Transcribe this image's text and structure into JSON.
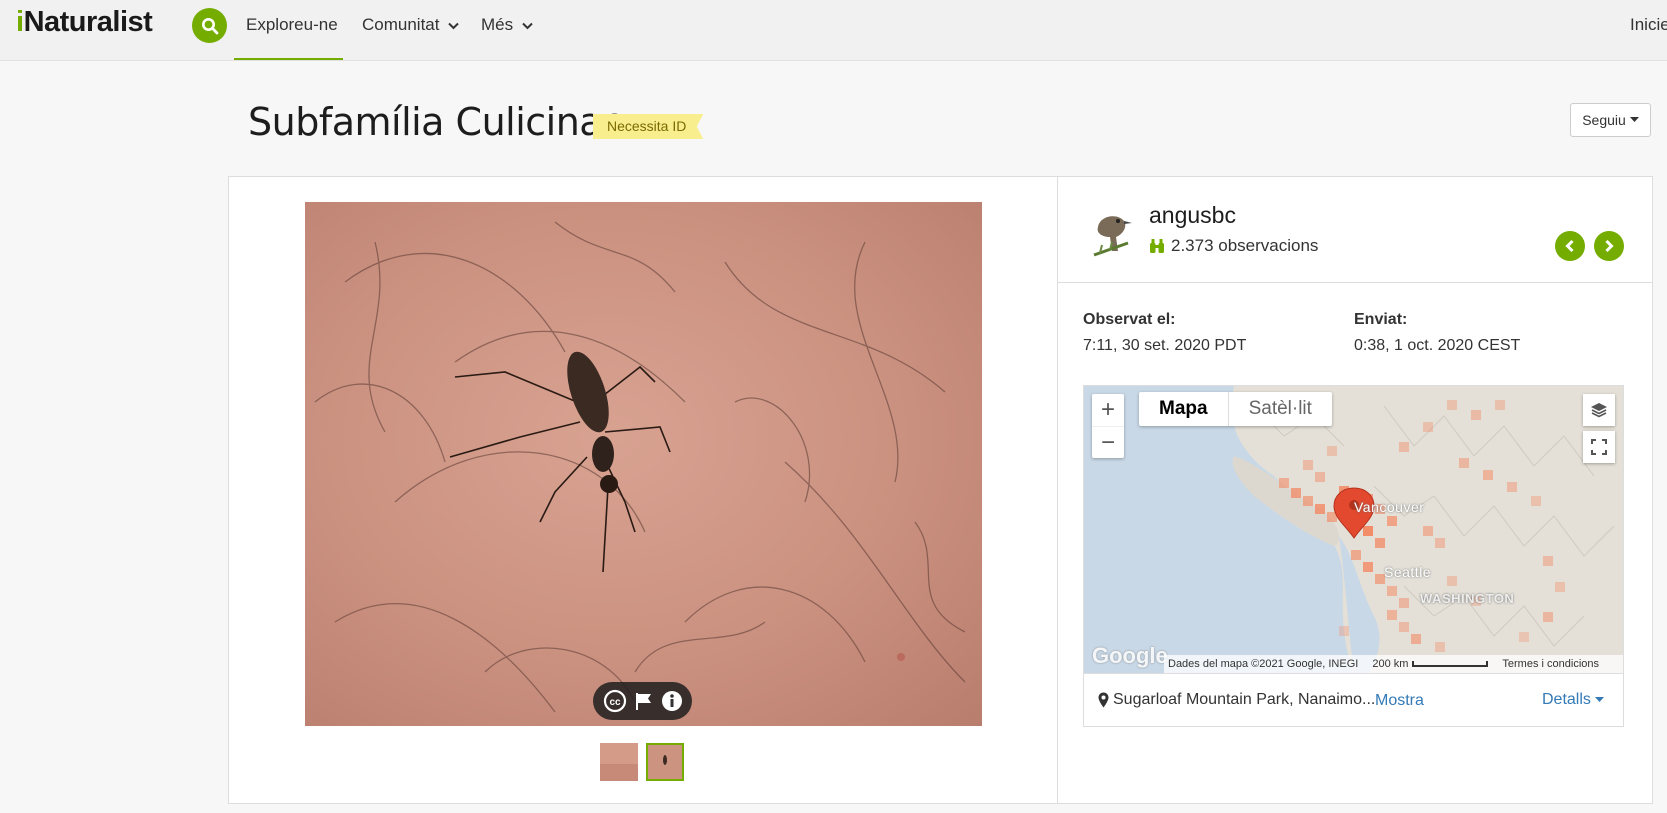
{
  "header": {
    "logo": "iNaturalist",
    "nav": {
      "explore": "Exploreu-ne",
      "community": "Comunitat",
      "more": "Més",
      "home": "Inicie"
    }
  },
  "observation": {
    "title": "Subfamília Culicinae",
    "quality_grade": "Necessita ID",
    "follow_label": "Seguiu"
  },
  "observer": {
    "name": "angusbc",
    "observations": "2.373 observacions"
  },
  "dates": {
    "observed_label": "Observat el:",
    "observed_value": "7:11, 30 set. 2020 PDT",
    "submitted_label": "Enviat:",
    "submitted_value": "0:38, 1 oct. 2020 CEST"
  },
  "map": {
    "type_map": "Mapa",
    "type_satellite": "Satèl·lit",
    "attribution": "Dades del mapa ©2021 Google, INEGI",
    "scale": "200 km",
    "terms": "Termes i condicions",
    "google": "Google",
    "label_vancouver": "Vancouver",
    "label_seattle": "Seattle",
    "label_washington": "WASHINGTON"
  },
  "place": {
    "name": "Sugarloaf Mountain Park, Nanaimo...",
    "more": "Mostra",
    "details": "Detalls"
  },
  "colors": {
    "brand": "#74ac00",
    "badge_bg": "#f8ee8e",
    "link": "#337ab7",
    "heat": "#f4835c"
  },
  "icons": [
    "search-icon",
    "chevron-down-icon",
    "creative-commons-icon",
    "flag-icon",
    "info-icon",
    "binoculars-icon",
    "chevron-left-icon",
    "chevron-right-icon",
    "layers-icon",
    "fullscreen-icon",
    "map-pin-icon",
    "location-pin-icon"
  ]
}
